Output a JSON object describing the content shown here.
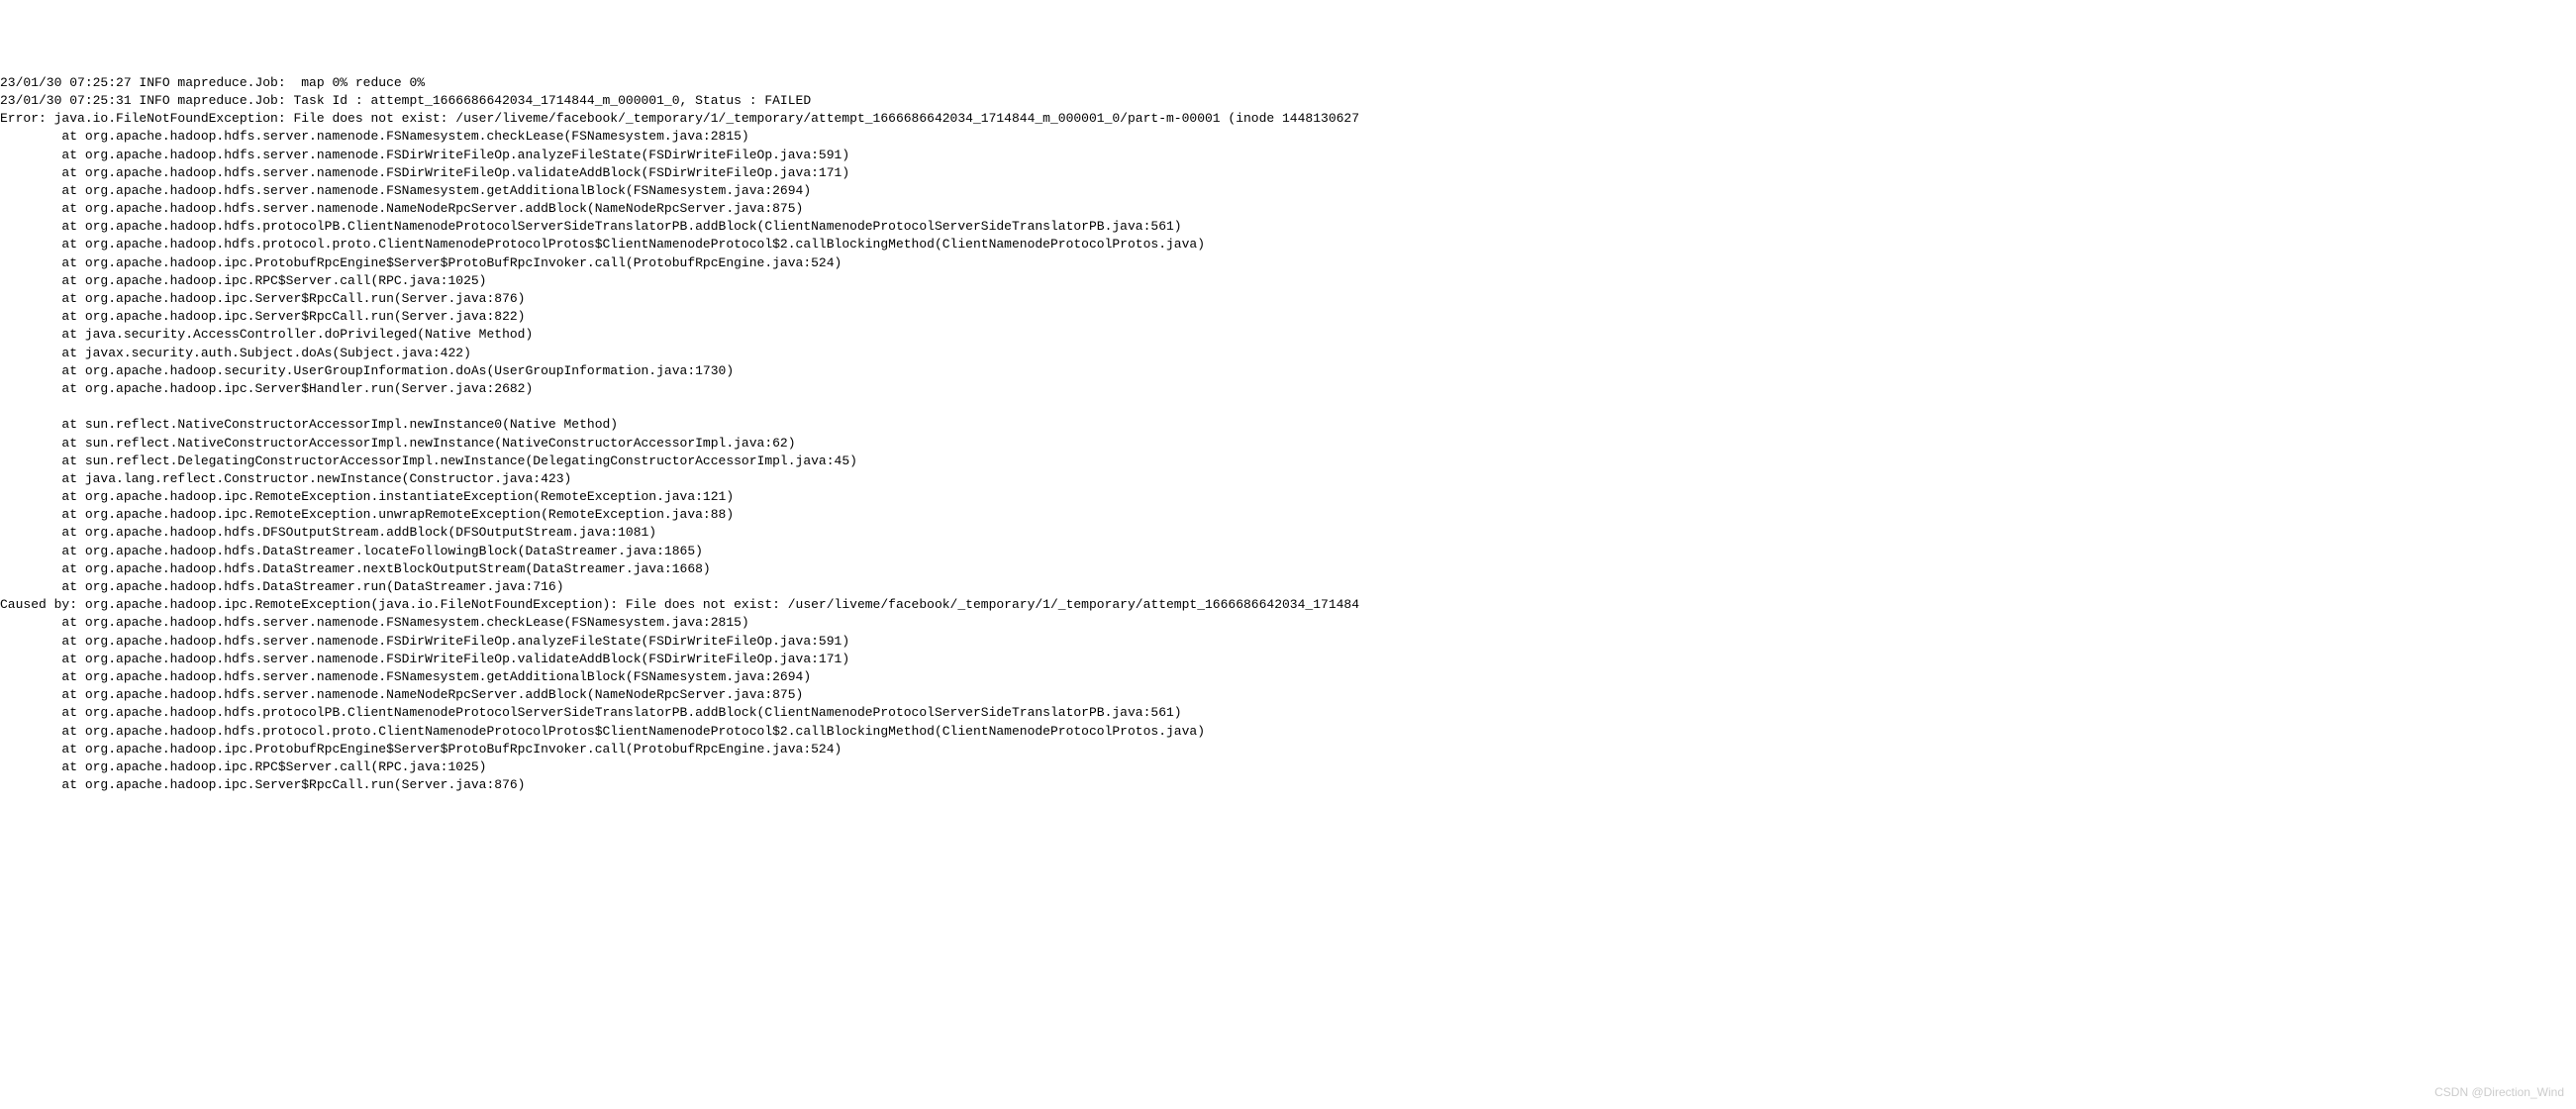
{
  "watermark": "CSDN @Direction_Wind",
  "lines": [
    "23/01/30 07:25:27 INFO mapreduce.Job:  map 0% reduce 0%",
    "23/01/30 07:25:31 INFO mapreduce.Job: Task Id : attempt_1666686642034_1714844_m_000001_0, Status : FAILED",
    "Error: java.io.FileNotFoundException: File does not exist: /user/liveme/facebook/_temporary/1/_temporary/attempt_1666686642034_1714844_m_000001_0/part-m-00001 (inode 1448130627",
    "        at org.apache.hadoop.hdfs.server.namenode.FSNamesystem.checkLease(FSNamesystem.java:2815)",
    "        at org.apache.hadoop.hdfs.server.namenode.FSDirWriteFileOp.analyzeFileState(FSDirWriteFileOp.java:591)",
    "        at org.apache.hadoop.hdfs.server.namenode.FSDirWriteFileOp.validateAddBlock(FSDirWriteFileOp.java:171)",
    "        at org.apache.hadoop.hdfs.server.namenode.FSNamesystem.getAdditionalBlock(FSNamesystem.java:2694)",
    "        at org.apache.hadoop.hdfs.server.namenode.NameNodeRpcServer.addBlock(NameNodeRpcServer.java:875)",
    "        at org.apache.hadoop.hdfs.protocolPB.ClientNamenodeProtocolServerSideTranslatorPB.addBlock(ClientNamenodeProtocolServerSideTranslatorPB.java:561)",
    "        at org.apache.hadoop.hdfs.protocol.proto.ClientNamenodeProtocolProtos$ClientNamenodeProtocol$2.callBlockingMethod(ClientNamenodeProtocolProtos.java)",
    "        at org.apache.hadoop.ipc.ProtobufRpcEngine$Server$ProtoBufRpcInvoker.call(ProtobufRpcEngine.java:524)",
    "        at org.apache.hadoop.ipc.RPC$Server.call(RPC.java:1025)",
    "        at org.apache.hadoop.ipc.Server$RpcCall.run(Server.java:876)",
    "        at org.apache.hadoop.ipc.Server$RpcCall.run(Server.java:822)",
    "        at java.security.AccessController.doPrivileged(Native Method)",
    "        at javax.security.auth.Subject.doAs(Subject.java:422)",
    "        at org.apache.hadoop.security.UserGroupInformation.doAs(UserGroupInformation.java:1730)",
    "        at org.apache.hadoop.ipc.Server$Handler.run(Server.java:2682)",
    "",
    "        at sun.reflect.NativeConstructorAccessorImpl.newInstance0(Native Method)",
    "        at sun.reflect.NativeConstructorAccessorImpl.newInstance(NativeConstructorAccessorImpl.java:62)",
    "        at sun.reflect.DelegatingConstructorAccessorImpl.newInstance(DelegatingConstructorAccessorImpl.java:45)",
    "        at java.lang.reflect.Constructor.newInstance(Constructor.java:423)",
    "        at org.apache.hadoop.ipc.RemoteException.instantiateException(RemoteException.java:121)",
    "        at org.apache.hadoop.ipc.RemoteException.unwrapRemoteException(RemoteException.java:88)",
    "        at org.apache.hadoop.hdfs.DFSOutputStream.addBlock(DFSOutputStream.java:1081)",
    "        at org.apache.hadoop.hdfs.DataStreamer.locateFollowingBlock(DataStreamer.java:1865)",
    "        at org.apache.hadoop.hdfs.DataStreamer.nextBlockOutputStream(DataStreamer.java:1668)",
    "        at org.apache.hadoop.hdfs.DataStreamer.run(DataStreamer.java:716)",
    "Caused by: org.apache.hadoop.ipc.RemoteException(java.io.FileNotFoundException): File does not exist: /user/liveme/facebook/_temporary/1/_temporary/attempt_1666686642034_171484",
    "        at org.apache.hadoop.hdfs.server.namenode.FSNamesystem.checkLease(FSNamesystem.java:2815)",
    "        at org.apache.hadoop.hdfs.server.namenode.FSDirWriteFileOp.analyzeFileState(FSDirWriteFileOp.java:591)",
    "        at org.apache.hadoop.hdfs.server.namenode.FSDirWriteFileOp.validateAddBlock(FSDirWriteFileOp.java:171)",
    "        at org.apache.hadoop.hdfs.server.namenode.FSNamesystem.getAdditionalBlock(FSNamesystem.java:2694)",
    "        at org.apache.hadoop.hdfs.server.namenode.NameNodeRpcServer.addBlock(NameNodeRpcServer.java:875)",
    "        at org.apache.hadoop.hdfs.protocolPB.ClientNamenodeProtocolServerSideTranslatorPB.addBlock(ClientNamenodeProtocolServerSideTranslatorPB.java:561)",
    "        at org.apache.hadoop.hdfs.protocol.proto.ClientNamenodeProtocolProtos$ClientNamenodeProtocol$2.callBlockingMethod(ClientNamenodeProtocolProtos.java)",
    "        at org.apache.hadoop.ipc.ProtobufRpcEngine$Server$ProtoBufRpcInvoker.call(ProtobufRpcEngine.java:524)",
    "        at org.apache.hadoop.ipc.RPC$Server.call(RPC.java:1025)",
    "        at org.apache.hadoop.ipc.Server$RpcCall.run(Server.java:876)"
  ]
}
